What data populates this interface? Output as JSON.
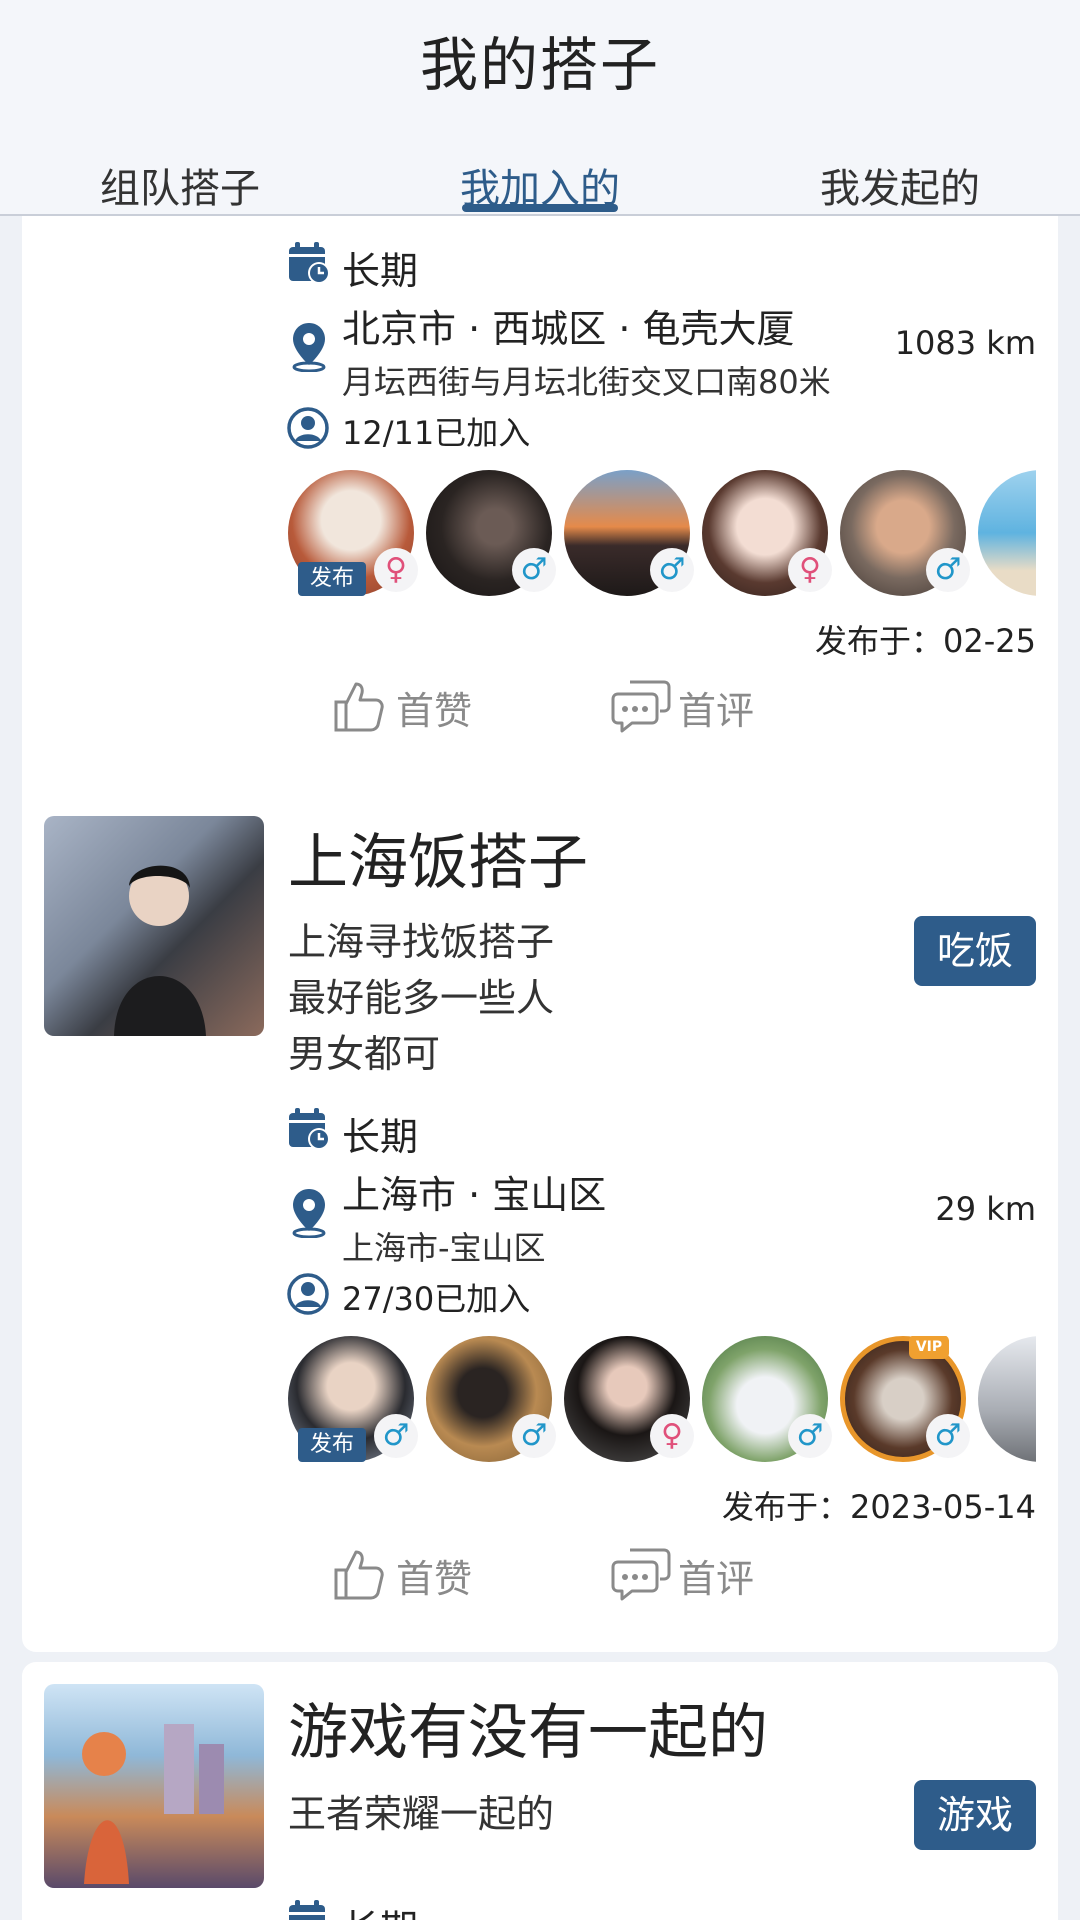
{
  "header": {
    "title": "我的搭子",
    "tabs": [
      {
        "label": "组队搭子",
        "active": false
      },
      {
        "label": "我加入的",
        "active": true
      },
      {
        "label": "我发起的",
        "active": false
      }
    ]
  },
  "colors": {
    "accent": "#2e5c8a",
    "male": "#2196c9",
    "female": "#e0507a",
    "muted": "#8a8a8a"
  },
  "cards": [
    {
      "duration": "长期",
      "address_main": "北京市 · 西城区 · 龟壳大厦",
      "address_sub": "月坛西街与月坛北街交叉口南80米",
      "distance": "1083 km",
      "joined": "12/11已加入",
      "members": [
        {
          "gender": "female",
          "icon": "female-icon",
          "publisher": true,
          "badge": "发布"
        },
        {
          "gender": "male",
          "icon": "male-icon"
        },
        {
          "gender": "male",
          "icon": "male-icon"
        },
        {
          "gender": "female",
          "icon": "female-icon"
        },
        {
          "gender": "male",
          "icon": "male-icon"
        }
      ],
      "published": "发布于：02-25",
      "like_label": "首赞",
      "comment_label": "首评"
    },
    {
      "title": "上海饭搭子",
      "description": "上海寻找饭搭子\n最好能多一些人\n男女都可",
      "tag": "吃饭",
      "duration": "长期",
      "address_main": "上海市 · 宝山区",
      "address_sub": "上海市-宝山区",
      "distance": "29 km",
      "joined": "27/30已加入",
      "members": [
        {
          "gender": "male",
          "icon": "male-icon",
          "publisher": true,
          "badge": "发布"
        },
        {
          "gender": "male",
          "icon": "male-icon"
        },
        {
          "gender": "female",
          "icon": "female-icon"
        },
        {
          "gender": "male",
          "icon": "male-icon"
        },
        {
          "gender": "male",
          "icon": "male-icon",
          "vip": true,
          "vip_label": "VIP"
        }
      ],
      "published": "发布于：2023-05-14",
      "like_label": "首赞",
      "comment_label": "首评"
    },
    {
      "title": "游戏有没有一起的",
      "description": "王者荣耀一起的",
      "tag": "游戏",
      "duration": "长期"
    }
  ]
}
